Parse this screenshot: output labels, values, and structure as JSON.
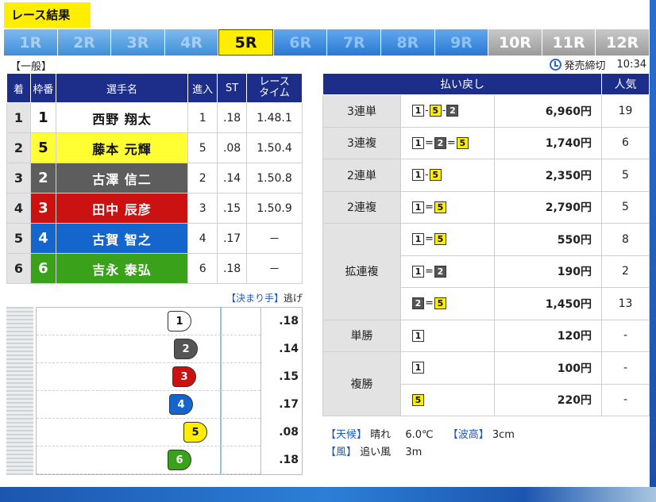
{
  "header": {
    "title": "レース結果",
    "tabs": [
      {
        "label": "1R",
        "state": "past"
      },
      {
        "label": "2R",
        "state": "past"
      },
      {
        "label": "3R",
        "state": "past"
      },
      {
        "label": "4R",
        "state": "past"
      },
      {
        "label": "5R",
        "state": "current"
      },
      {
        "label": "6R",
        "state": "future"
      },
      {
        "label": "7R",
        "state": "future"
      },
      {
        "label": "8R",
        "state": "future"
      },
      {
        "label": "9R",
        "state": "future"
      },
      {
        "label": "10R",
        "state": "closed"
      },
      {
        "label": "11R",
        "state": "closed"
      },
      {
        "label": "12R",
        "state": "closed"
      }
    ],
    "grade": "【一般】",
    "deadline_label": "発売締切",
    "deadline_time": "10:34",
    "clock_icon": "clock-icon"
  },
  "results": {
    "headers": [
      "着",
      "枠番",
      "選手名",
      "進入",
      "ST",
      "レース\nタイム"
    ],
    "rows": [
      {
        "pos": "1",
        "frame": "1",
        "name": "西野 翔太",
        "course": "1",
        "st": ".18",
        "time": "1.48.1",
        "frame_color": "#ffffff",
        "text_color": "#111111"
      },
      {
        "pos": "2",
        "frame": "5",
        "name": "藤本 元輝",
        "course": "5",
        "st": ".08",
        "time": "1.50.4",
        "frame_color": "#ffff33",
        "text_color": "#111111"
      },
      {
        "pos": "3",
        "frame": "2",
        "name": "古澤 信二",
        "course": "2",
        "st": ".14",
        "time": "1.50.8",
        "frame_color": "#5d5d5d",
        "text_color": "#ffffff"
      },
      {
        "pos": "4",
        "frame": "3",
        "name": "田中 辰彦",
        "course": "3",
        "st": ".15",
        "time": "1.50.9",
        "frame_color": "#cc1111",
        "text_color": "#ffffff"
      },
      {
        "pos": "5",
        "frame": "4",
        "name": "古賀 智之",
        "course": "4",
        "st": ".17",
        "time": "－",
        "frame_color": "#1466cc",
        "text_color": "#ffffff"
      },
      {
        "pos": "6",
        "frame": "6",
        "name": "吉永 泰弘",
        "course": "6",
        "st": ".18",
        "time": "－",
        "frame_color": "#3aa11a",
        "text_color": "#ffffff"
      }
    ]
  },
  "start": {
    "kimarite_label": "【決まり手】",
    "kimarite": "逃げ",
    "boats": [
      {
        "num": "1",
        "st": ".18",
        "color": "#ffffff",
        "text": "#111111",
        "st_value": 0.18
      },
      {
        "num": "2",
        "st": ".14",
        "color": "#555555",
        "text": "#ffffff",
        "st_value": 0.14
      },
      {
        "num": "3",
        "st": ".15",
        "color": "#cc1111",
        "text": "#ffffff",
        "st_value": 0.15
      },
      {
        "num": "4",
        "st": ".17",
        "color": "#1466cc",
        "text": "#ffffff",
        "st_value": 0.17
      },
      {
        "num": "5",
        "st": ".08",
        "color": "#ffee00",
        "text": "#111111",
        "st_value": 0.08
      },
      {
        "num": "6",
        "st": ".18",
        "color": "#3aa11a",
        "text": "#ffffff",
        "st_value": 0.18
      }
    ]
  },
  "payout": {
    "headers": [
      "払い戻し",
      "人気"
    ],
    "rows": [
      {
        "bet": "3連単",
        "combo": [
          "1",
          "-",
          "5",
          "-",
          "2"
        ],
        "amount": "6,960円",
        "pop": "19"
      },
      {
        "bet": "3連複",
        "combo": [
          "1",
          "=",
          "2",
          "=",
          "5"
        ],
        "amount": "1,740円",
        "pop": "6"
      },
      {
        "bet": "2連単",
        "combo": [
          "1",
          "-",
          "5"
        ],
        "amount": "2,350円",
        "pop": "5"
      },
      {
        "bet": "2連複",
        "combo": [
          "1",
          "=",
          "5"
        ],
        "amount": "2,790円",
        "pop": "5"
      },
      {
        "bet": "拡連複",
        "combo": [
          "1",
          "=",
          "5"
        ],
        "amount": "550円",
        "pop": "8"
      },
      {
        "bet": "",
        "combo": [
          "1",
          "=",
          "2"
        ],
        "amount": "190円",
        "pop": "2"
      },
      {
        "bet": "",
        "combo": [
          "2",
          "=",
          "5"
        ],
        "amount": "1,450円",
        "pop": "13"
      },
      {
        "bet": "単勝",
        "combo": [
          "1"
        ],
        "amount": "120円",
        "pop": "-"
      },
      {
        "bet": "複勝",
        "combo": [
          "1"
        ],
        "amount": "100円",
        "pop": "-"
      },
      {
        "bet": "",
        "combo": [
          "5"
        ],
        "amount": "220円",
        "pop": "-"
      }
    ]
  },
  "weather": {
    "weather_label": "【天候】",
    "weather_value": "晴れ",
    "temp": "6.0℃",
    "wave_label": "【波高】",
    "wave_value": "3cm",
    "wind_label": "【風】",
    "wind_dir": "追い風",
    "wind_speed": "3m"
  }
}
